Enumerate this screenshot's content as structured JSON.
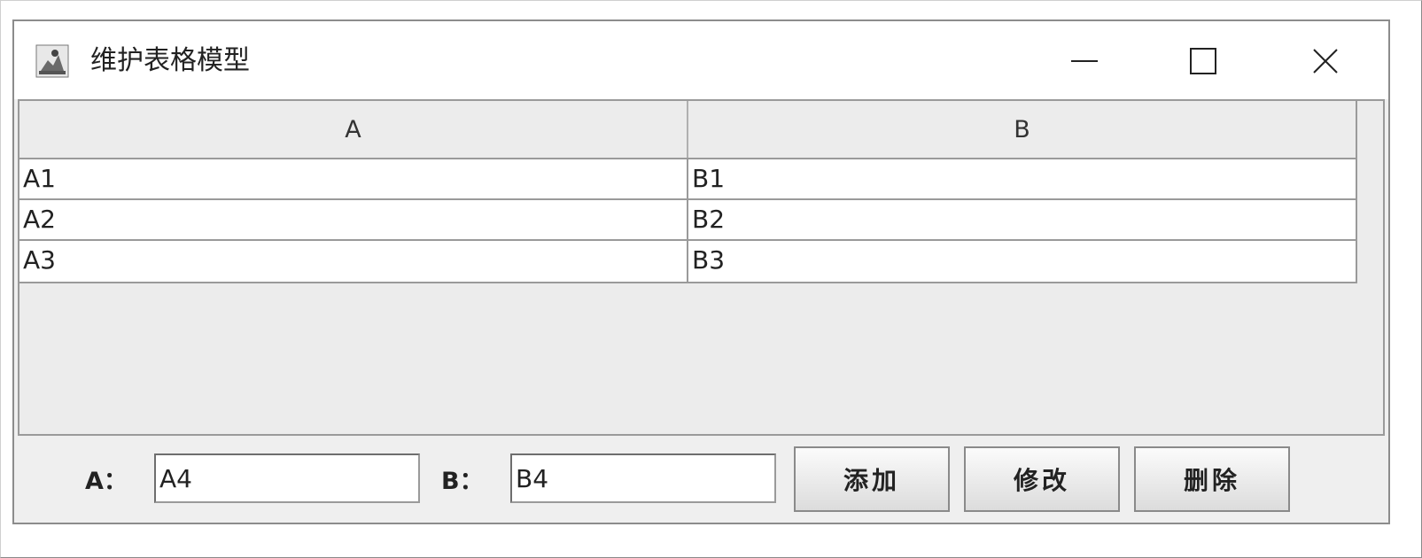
{
  "window": {
    "title": "维护表格模型",
    "icon": "java-app-icon",
    "controls": [
      "minimize-icon",
      "maximize-icon",
      "close-icon"
    ]
  },
  "table": {
    "columns": [
      "A",
      "B"
    ],
    "rows": [
      [
        "A1",
        "B1"
      ],
      [
        "A2",
        "B2"
      ],
      [
        "A3",
        "B3"
      ]
    ]
  },
  "form": {
    "label_a": "A：",
    "value_a": "A4",
    "label_b": "B：",
    "value_b": "B4"
  },
  "buttons": {
    "add": "添加",
    "edit": "修改",
    "delete": "删除"
  }
}
